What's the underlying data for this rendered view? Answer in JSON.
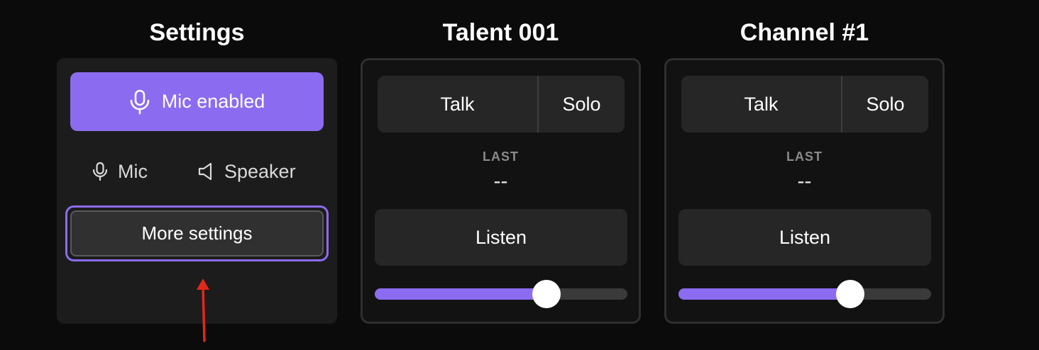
{
  "settings": {
    "title": "Settings",
    "mic_enabled_label": "Mic enabled",
    "mic_label": "Mic",
    "speaker_label": "Speaker",
    "more_settings_label": "More settings"
  },
  "channels": [
    {
      "title": "Talent 001",
      "talk_label": "Talk",
      "solo_label": "Solo",
      "last_label": "LAST",
      "last_value": "--",
      "listen_label": "Listen",
      "volume_fraction": 0.68
    },
    {
      "title": "Channel #1",
      "talk_label": "Talk",
      "solo_label": "Solo",
      "last_label": "LAST",
      "last_value": "--",
      "listen_label": "Listen",
      "volume_fraction": 0.68
    }
  ],
  "colors": {
    "accent": "#8b6cf0",
    "annotation_arrow": "#e0281a"
  },
  "icons": {
    "mic": "microphone-icon",
    "speaker": "speaker-icon"
  }
}
